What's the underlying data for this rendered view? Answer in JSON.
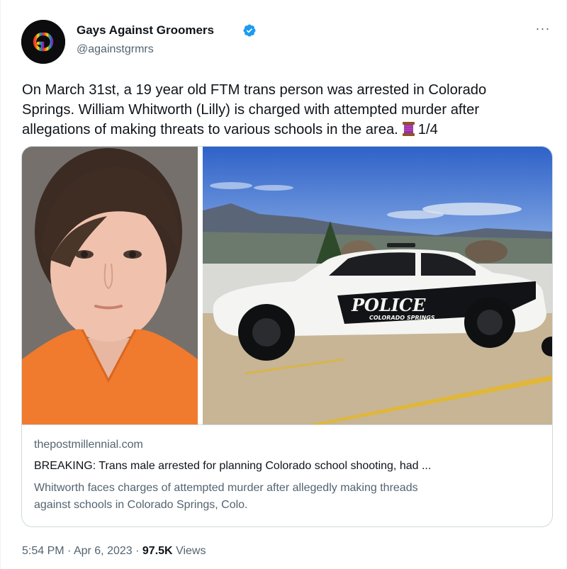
{
  "author": {
    "display_name": "Gays Against Groomers",
    "handle": "@againstgrmrs",
    "verified": true,
    "avatar_icon": "gag-logo",
    "verified_icon": "verified-badge-icon",
    "more_icon": "more-options-icon",
    "more_label": "···"
  },
  "tweet": {
    "text_lines": [
      "On March 31st, a 19 year old FTM trans person was arrested in Colorado",
      "Springs. William Whitworth (Lilly) is charged with attempted murder after",
      "allegations of making threats to various schools in the area."
    ],
    "emoji_icon": "thread-spool-icon",
    "thread_counter": "1/4"
  },
  "card": {
    "left_image": "mugshot-photo",
    "right_image": "police-car-photo",
    "car_text": "POLICE",
    "car_subtext": "COLORADO SPRINGS",
    "domain": "thepostmillennial.com",
    "title": "BREAKING: Trans male arrested for planning Colorado school shooting, had ...",
    "description_lines": [
      "Whitworth faces charges of attempted murder after allegedly making threads",
      "against schools in Colorado Springs, Colo."
    ]
  },
  "meta": {
    "time": "5:54 PM",
    "separator": "·",
    "date": "Apr 6, 2023",
    "views_count": "97.5K",
    "views_label": "Views"
  },
  "colors": {
    "text": "#0f1419",
    "secondary": "#536471",
    "border": "#cfd9de",
    "verified_blue": "#1d9bf0"
  }
}
